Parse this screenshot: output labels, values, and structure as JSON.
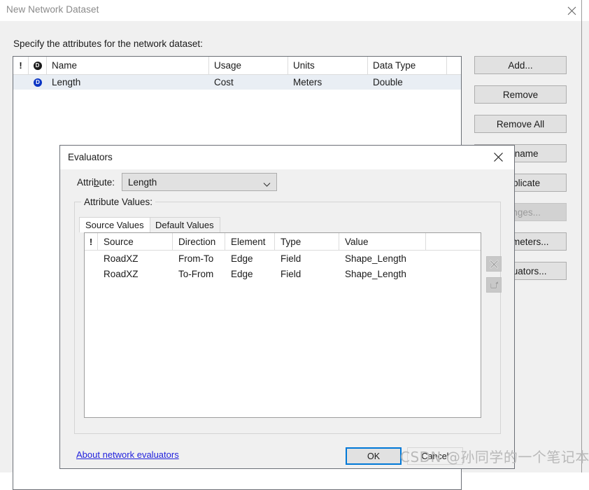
{
  "base_window": {
    "title": "New Network Dataset",
    "close_icon": "close-icon",
    "prompt": "Specify the attributes for the network dataset:",
    "attributes_grid": {
      "columns": [
        "!",
        "D",
        "Name",
        "Usage",
        "Units",
        "Data Type"
      ],
      "rows": [
        {
          "bang": "",
          "default_marker": "D",
          "name": "Length",
          "usage": "Cost",
          "units": "Meters",
          "data_type": "Double"
        }
      ]
    },
    "side_buttons": [
      {
        "label": "Add...",
        "enabled": true
      },
      {
        "label": "Remove",
        "enabled": true
      },
      {
        "label": "Remove All",
        "enabled": true
      },
      {
        "label": "Rename",
        "enabled": true
      },
      {
        "label": "Duplicate",
        "enabled": true
      },
      {
        "label": "Ranges...",
        "enabled": false
      },
      {
        "label": "Parameters...",
        "enabled": true
      },
      {
        "label": "Evaluators...",
        "enabled": true
      }
    ]
  },
  "evaluators_dialog": {
    "title": "Evaluators",
    "close_icon": "close-icon",
    "attribute_label_pre": "Attri",
    "attribute_label_mnemonic": "b",
    "attribute_label_post": "ute:",
    "attribute_value": "Length",
    "attribute_dropdown_icon": "chevron-down-icon",
    "group_legend": "Attribute Values:",
    "tabs": [
      {
        "label": "Source Values",
        "active": true
      },
      {
        "label": "Default Values",
        "active": false
      }
    ],
    "list": {
      "columns": [
        "!",
        "Source",
        "Direction",
        "Element",
        "Type",
        "Value",
        ""
      ],
      "rows": [
        {
          "bang": "",
          "source": "RoadXZ",
          "direction": "From-To",
          "element": "Edge",
          "type": "Field",
          "value": "Shape_Length",
          "extra": ""
        },
        {
          "bang": "",
          "source": "RoadXZ",
          "direction": "To-From",
          "element": "Edge",
          "type": "Field",
          "value": "Shape_Length",
          "extra": ""
        }
      ]
    },
    "mini_buttons": [
      {
        "name": "evaluator-properties-button",
        "icon": "crossed-tools-icon",
        "enabled": false
      },
      {
        "name": "evaluator-copy-button",
        "icon": "paint-bucket-icon",
        "enabled": false
      }
    ],
    "about_link": "About network evaluators",
    "ok_label": "OK",
    "cancel_label": "Cancel"
  },
  "watermark": "CSDN @孙同学的一个笔记本",
  "colors": {
    "window_bg": "#f0f0f0",
    "titlebar_bg": "#ffffff",
    "field_bg": "#ffffff",
    "button_face": "#e1e1e1",
    "accent_focus": "#0078d7",
    "link": "#2222dd",
    "selected_row": "#e9eef4",
    "default_marker_blue": "#0b35c4"
  }
}
